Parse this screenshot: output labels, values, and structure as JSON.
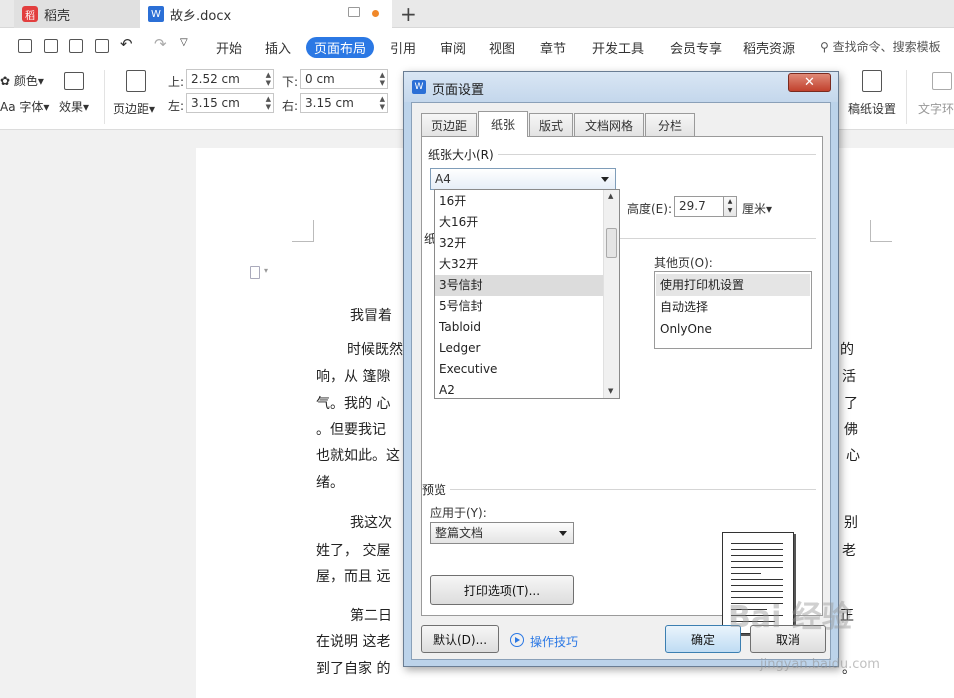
{
  "tabs": [
    {
      "name": "稻壳"
    },
    {
      "name": "故乡.docx"
    }
  ],
  "menu": {
    "items": [
      "开始",
      "插入",
      "页面布局",
      "引用",
      "审阅",
      "视图",
      "章节",
      "开发工具",
      "会员专享",
      "稻壳资源"
    ],
    "active": "页面布局",
    "search": "查找命令、搜索模板"
  },
  "ribbon": {
    "color_label": "颜色",
    "font_label": "字体",
    "effect_label": "效果",
    "margin_label": "页边距",
    "top_label": "上:",
    "top_value": "2.52 cm",
    "bottom_label": "下:",
    "bottom_value": "0 cm",
    "left_label": "左:",
    "left_value": "3.15 cm",
    "right_label": "右:",
    "right_value": "3.15 cm",
    "grid_paper_label": "稿纸设置",
    "text_wrap_label": "文字环"
  },
  "document": {
    "lines": [
      "我冒着",
      "时候既然",
      "响，从 篷隙",
      "气。我的 心",
      "。但要我记",
      "也就如此。这",
      "绪。",
      "我这次",
      "姓了， 交屋",
      "屋，而且 远",
      "第二日",
      "在说明 这老",
      "到了自家 的"
    ],
    "right_fragments": [
      "的",
      "活",
      "了",
      "佛",
      "心",
      "别",
      "老",
      "正",
      "。"
    ]
  },
  "dialog": {
    "title": "页面设置",
    "close": "✕",
    "tabs": [
      "页边距",
      "纸张",
      "版式",
      "文档网格",
      "分栏"
    ],
    "active_tab": "纸张",
    "paper_size_label": "纸张大小(R)",
    "paper_size_value": "A4",
    "paper_options": [
      "16开",
      "大16开",
      "32开",
      "大32开",
      "3号信封",
      "5号信封",
      "Tabloid",
      "Ledger",
      "Executive",
      "A2"
    ],
    "paper_selected": "3号信封",
    "height_label": "高度(E):",
    "height_value": "29.7",
    "unit_label": "厘米",
    "paper_source_partial": "纸",
    "other_pages_label": "其他页(O):",
    "other_pages_options": [
      "使用打印机设置",
      "自动选择",
      "OnlyOne"
    ],
    "other_pages_selected": "使用打印机设置",
    "preview_label": "预览",
    "apply_to_label": "应用于(Y):",
    "apply_to_value": "整篇文档",
    "print_options_button": "打印选项(T)...",
    "default_button": "默认(D)...",
    "tips_link": "操作技巧",
    "ok_button": "确定",
    "cancel_button": "取消"
  },
  "watermark": {
    "brand": "Bai 经验",
    "url": "jingyan.baidu.com"
  }
}
